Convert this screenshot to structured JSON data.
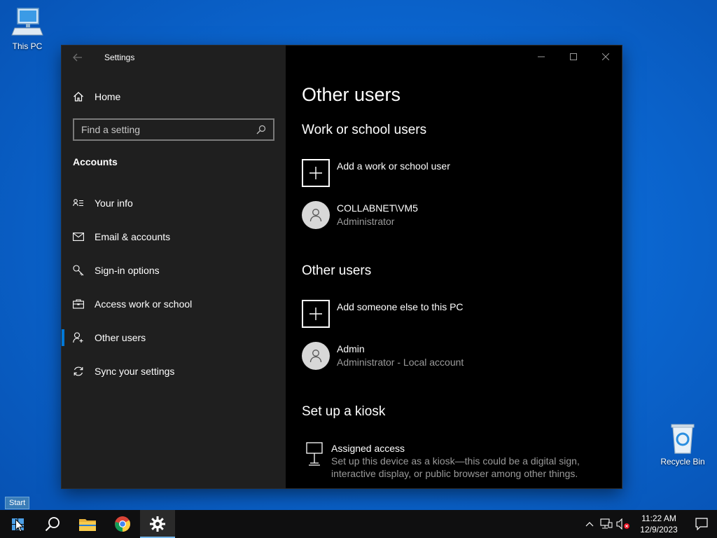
{
  "desktop": {
    "this_pc_label": "This PC",
    "recycle_bin_label": "Recycle Bin"
  },
  "window": {
    "title": "Settings",
    "back_icon": "arrow-left-icon"
  },
  "sidebar": {
    "home_label": "Home",
    "search_placeholder": "Find a setting",
    "section_title": "Accounts",
    "items": [
      {
        "label": "Your info",
        "icon": "person-card-icon"
      },
      {
        "label": "Email & accounts",
        "icon": "mail-icon"
      },
      {
        "label": "Sign-in options",
        "icon": "key-icon"
      },
      {
        "label": "Access work or school",
        "icon": "briefcase-icon"
      },
      {
        "label": "Other users",
        "icon": "person-add-icon",
        "active": true
      },
      {
        "label": "Sync your settings",
        "icon": "sync-icon"
      }
    ]
  },
  "content": {
    "page_title": "Other users",
    "work_section_title": "Work or school users",
    "add_work_label": "Add a work or school user",
    "work_user_name": "COLLABNET\\VM5",
    "work_user_role": "Administrator",
    "other_section_title": "Other users",
    "add_other_label": "Add someone else to this PC",
    "other_user_name": "Admin",
    "other_user_role": "Administrator - Local account",
    "kiosk_section_title": "Set up a kiosk",
    "kiosk_title": "Assigned access",
    "kiosk_description": "Set up this device as a kiosk—this could be a digital sign, interactive display, or public browser among other things."
  },
  "taskbar": {
    "start_tooltip": "Start",
    "time": "11:22 AM",
    "date": "12/9/2023"
  },
  "colors": {
    "accent": "#0078d7",
    "sidebar_bg": "#1f1f1f",
    "content_bg": "#000000",
    "secondary_text": "#9a9a9a"
  }
}
